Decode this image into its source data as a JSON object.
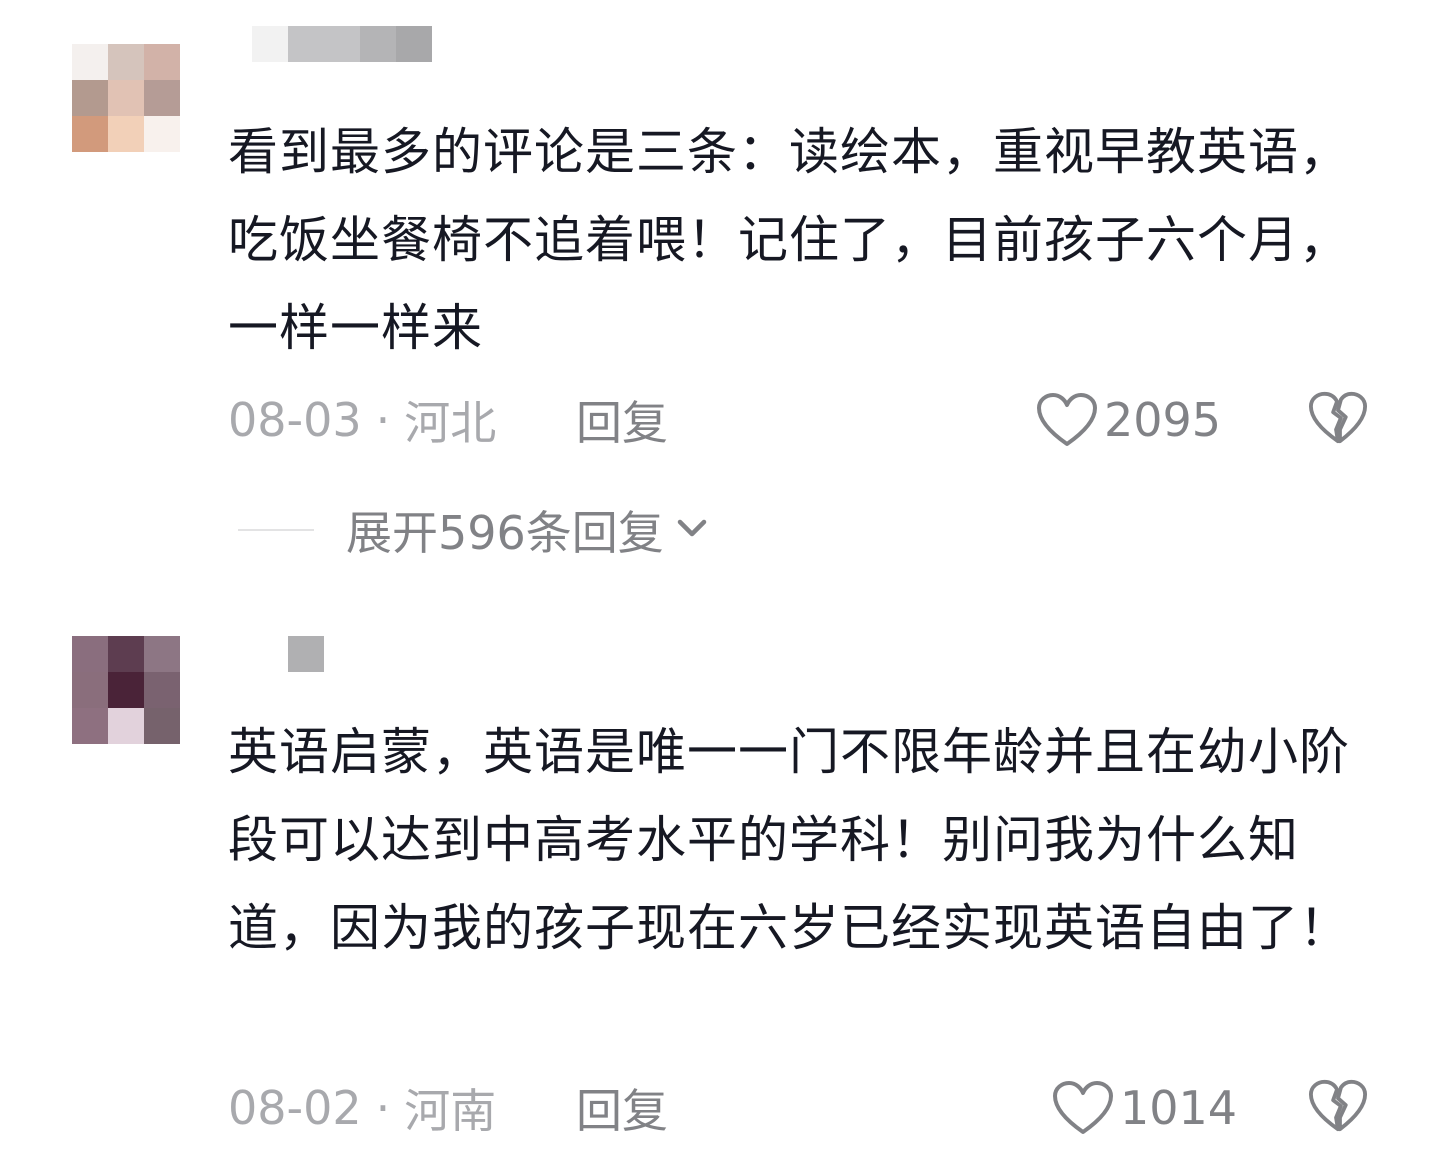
{
  "comments": [
    {
      "text": "看到最多的评论是三条：读绘本，重视早教英语，吃饭坐餐椅不追着喂！记住了，目前孩子六个月，一样一样来",
      "date": "08-03",
      "separator": "·",
      "location": "河北",
      "reply_label": "回复",
      "like_count": "2095",
      "avatar_pixels": [
        "#f4f0ee",
        "#d5c4bc",
        "#d2b2a8",
        "#b39a8f",
        "#e1c2b4",
        "#b59c96",
        "#d29a7c",
        "#f2d0b8",
        "#f8f1ed"
      ],
      "username_pixels": [
        "#f2f2f2",
        "#c4c4c6",
        "#b4b4b6",
        "#a8a8aa"
      ]
    },
    {
      "text": "英语启蒙，英语是唯一一门不限年龄并且在幼小阶段可以达到中高考水平的学科！别问我为什么知道，因为我的孩子现在六岁已经实现英语自由了！",
      "date": "08-02",
      "separator": "·",
      "location": "河南",
      "reply_label": "回复",
      "like_count": "1014",
      "avatar_pixels": [
        "#8a6e7e",
        "#5d3d50",
        "#8d7684",
        "#8a6e7c",
        "#4a2338",
        "#7a6270",
        "#8e7080",
        "#e2d2dc",
        "#76626c"
      ],
      "username_pixels": [
        "#b0b0b2"
      ]
    }
  ],
  "expand_replies": {
    "label": "展开596条回复"
  },
  "icons": {
    "like": "heart-outline-icon",
    "dislike": "broken-heart-icon",
    "expand": "chevron-down-icon"
  },
  "colors": {
    "text_primary": "#161823",
    "text_meta": "#a8a9ad",
    "text_secondary": "#818286"
  }
}
